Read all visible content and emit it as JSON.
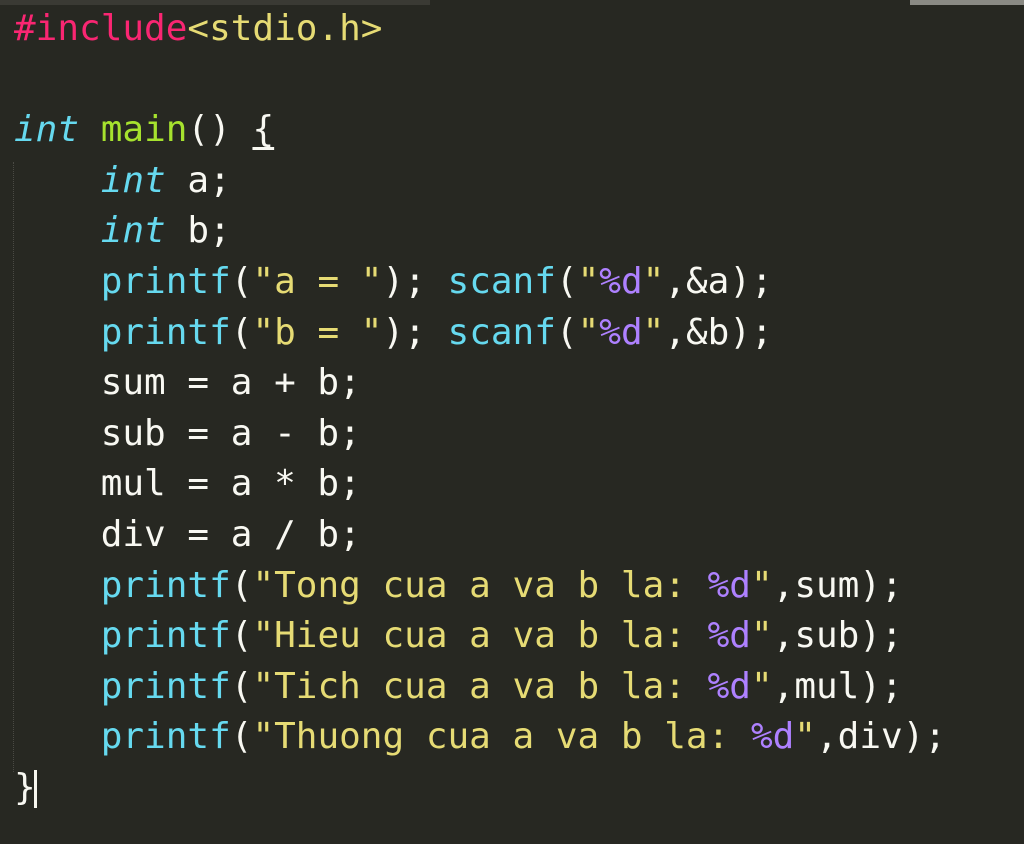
{
  "editor": {
    "theme_colors": {
      "background": "#272822",
      "preprocessor": "#f92672",
      "header": "#e6db74",
      "type": "#66d9ef",
      "function_name": "#a6e22e",
      "string": "#e6db74",
      "format_specifier": "#ae81ff",
      "plain": "#f8f8f2"
    },
    "lines": [
      [
        {
          "t": "pre",
          "v": "#include"
        },
        {
          "t": "hdr",
          "v": "<stdio.h>"
        }
      ],
      [],
      [
        {
          "t": "type",
          "v": "int"
        },
        {
          "t": "plain",
          "v": " "
        },
        {
          "t": "func",
          "v": "main"
        },
        {
          "t": "plain",
          "v": "() "
        },
        {
          "t": "brace",
          "v": "{"
        }
      ],
      [
        {
          "t": "plain",
          "v": "    "
        },
        {
          "t": "type",
          "v": "int"
        },
        {
          "t": "plain",
          "v": " a;"
        }
      ],
      [
        {
          "t": "plain",
          "v": "    "
        },
        {
          "t": "type",
          "v": "int"
        },
        {
          "t": "plain",
          "v": " b;"
        }
      ],
      [
        {
          "t": "plain",
          "v": "    "
        },
        {
          "t": "call",
          "v": "printf"
        },
        {
          "t": "plain",
          "v": "("
        },
        {
          "t": "str",
          "v": "\"a = \""
        },
        {
          "t": "plain",
          "v": "); "
        },
        {
          "t": "call",
          "v": "scanf"
        },
        {
          "t": "plain",
          "v": "("
        },
        {
          "t": "str",
          "v": "\""
        },
        {
          "t": "fmt",
          "v": "%d"
        },
        {
          "t": "str",
          "v": "\""
        },
        {
          "t": "plain",
          "v": ",&a);"
        }
      ],
      [
        {
          "t": "plain",
          "v": "    "
        },
        {
          "t": "call",
          "v": "printf"
        },
        {
          "t": "plain",
          "v": "("
        },
        {
          "t": "str",
          "v": "\"b = \""
        },
        {
          "t": "plain",
          "v": "); "
        },
        {
          "t": "call",
          "v": "scanf"
        },
        {
          "t": "plain",
          "v": "("
        },
        {
          "t": "str",
          "v": "\""
        },
        {
          "t": "fmt",
          "v": "%d"
        },
        {
          "t": "str",
          "v": "\""
        },
        {
          "t": "plain",
          "v": ",&b);"
        }
      ],
      [
        {
          "t": "plain",
          "v": "    sum = a + b;"
        }
      ],
      [
        {
          "t": "plain",
          "v": "    sub = a - b;"
        }
      ],
      [
        {
          "t": "plain",
          "v": "    mul = a * b;"
        }
      ],
      [
        {
          "t": "plain",
          "v": "    div = a / b;"
        }
      ],
      [
        {
          "t": "plain",
          "v": "    "
        },
        {
          "t": "call",
          "v": "printf"
        },
        {
          "t": "plain",
          "v": "("
        },
        {
          "t": "str",
          "v": "\"Tong cua a va b la: "
        },
        {
          "t": "fmt",
          "v": "%d"
        },
        {
          "t": "str",
          "v": "\""
        },
        {
          "t": "plain",
          "v": ",sum);"
        }
      ],
      [
        {
          "t": "plain",
          "v": "    "
        },
        {
          "t": "call",
          "v": "printf"
        },
        {
          "t": "plain",
          "v": "("
        },
        {
          "t": "str",
          "v": "\"Hieu cua a va b la: "
        },
        {
          "t": "fmt",
          "v": "%d"
        },
        {
          "t": "str",
          "v": "\""
        },
        {
          "t": "plain",
          "v": ",sub);"
        }
      ],
      [
        {
          "t": "plain",
          "v": "    "
        },
        {
          "t": "call",
          "v": "printf"
        },
        {
          "t": "plain",
          "v": "("
        },
        {
          "t": "str",
          "v": "\"Tich cua a va b la: "
        },
        {
          "t": "fmt",
          "v": "%d"
        },
        {
          "t": "str",
          "v": "\""
        },
        {
          "t": "plain",
          "v": ",mul);"
        }
      ],
      [
        {
          "t": "plain",
          "v": "    "
        },
        {
          "t": "call",
          "v": "printf"
        },
        {
          "t": "plain",
          "v": "("
        },
        {
          "t": "str",
          "v": "\"Thuong cua a va b la: "
        },
        {
          "t": "fmt",
          "v": "%d"
        },
        {
          "t": "str",
          "v": "\""
        },
        {
          "t": "plain",
          "v": ",div);"
        }
      ],
      [
        {
          "t": "plain",
          "v": "}"
        },
        {
          "t": "cursor",
          "v": ""
        }
      ]
    ]
  }
}
